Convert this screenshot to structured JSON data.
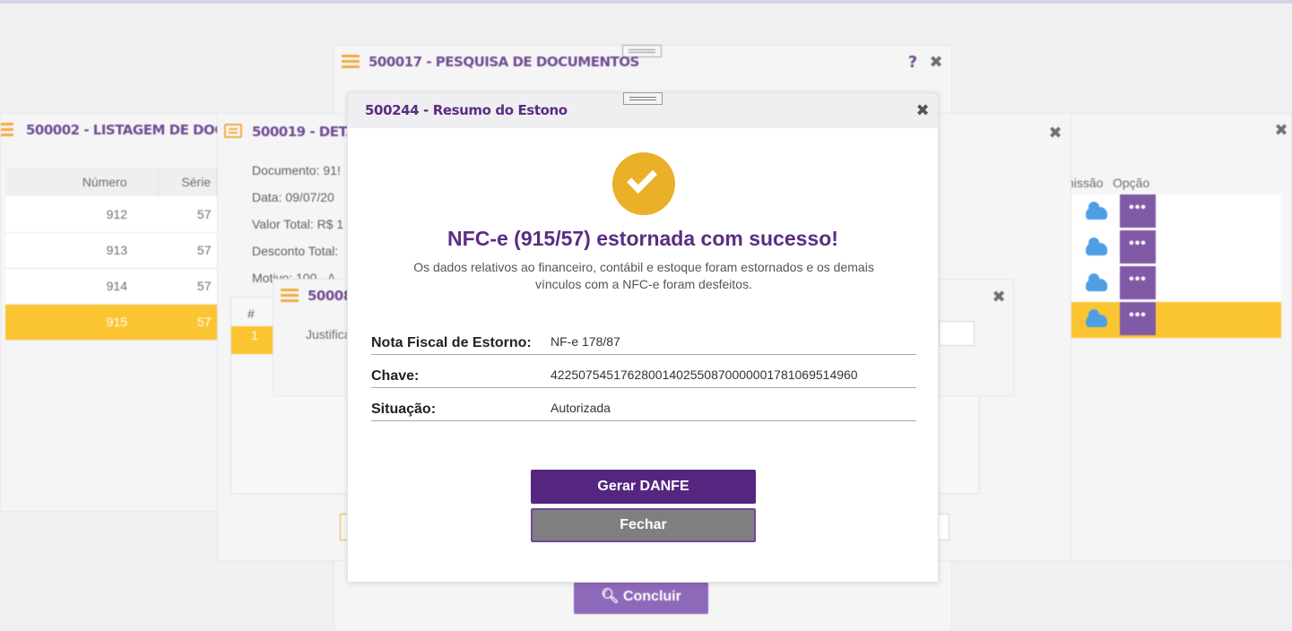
{
  "background": {
    "win_listagem": {
      "title": "500002 - LISTAGEM DE DOCUI",
      "columns": [
        "Número",
        "Série"
      ],
      "rows": [
        {
          "numero": "912",
          "serie": "57"
        },
        {
          "numero": "913",
          "serie": "57"
        },
        {
          "numero": "914",
          "serie": "57"
        },
        {
          "numero": "915",
          "serie": "57"
        }
      ]
    },
    "win_pesquisa": {
      "title": "500017 - PESQUISA DE DOCUMENTOS",
      "help": "?",
      "concluir_label": "Concluir"
    },
    "win_detalhe": {
      "title": "500019 - DETA",
      "lines": [
        "Documento: 91!",
        "Data:  09/07/20",
        "Valor Total:  R$ 1",
        "Desconto Total:",
        "Motivo:  100 - A"
      ],
      "grid_hash": "#",
      "grid_first": "1"
    },
    "win_justif": {
      "title": "50008",
      "label": "Justifica"
    },
    "right_columns": {
      "emissao": "nissão",
      "opcao": "Opção"
    },
    "opt_label": "•••"
  },
  "modal": {
    "title": "500244 - Resumo do Estono",
    "success_title": "NFC-e (915/57) estornada com sucesso!",
    "success_desc": "Os dados relativos ao financeiro, contábil e estoque foram estornados e os demais vínculos com a NFC-e foram desfeitos.",
    "info": [
      {
        "label": "Nota Fiscal de Estorno:",
        "value": "NF-e 178/87"
      },
      {
        "label": "Chave:",
        "value": "42250754517628001402550870000001781069514960"
      },
      {
        "label": "Situação:",
        "value": "Autorizada"
      }
    ],
    "btn_danfe": "Gerar DANFE",
    "btn_fechar": "Fechar"
  },
  "colors": {
    "accent_purple": "#5b2d82",
    "accent_orange": "#f39c1f",
    "selected_row": "#fbbb0d",
    "success_icon": "#e9b028"
  }
}
